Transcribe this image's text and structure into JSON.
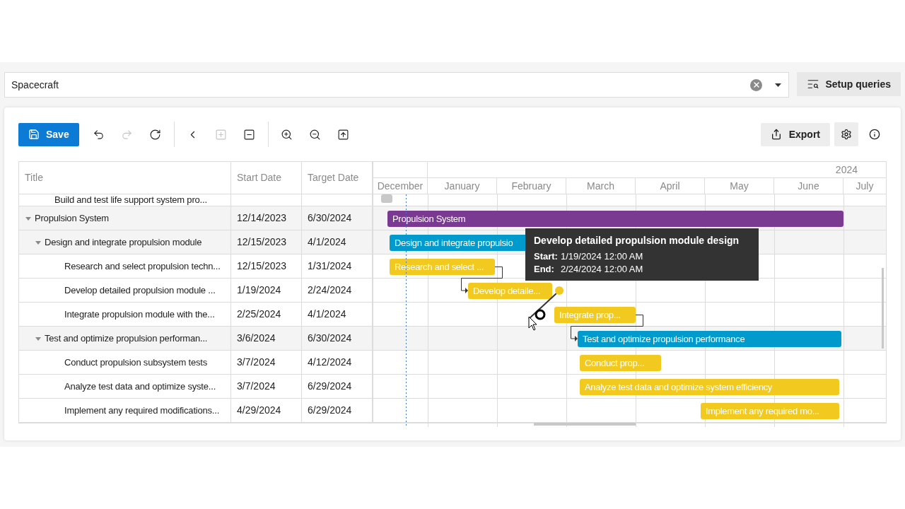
{
  "search": {
    "value": "Spacecraft"
  },
  "setup_button": "Setup queries",
  "toolbar": {
    "save": "Save",
    "tools": [
      {
        "kind": "undo",
        "disabled": false
      },
      {
        "kind": "redo",
        "disabled": true
      },
      {
        "kind": "refresh",
        "disabled": false
      },
      {
        "kind": "separator"
      },
      {
        "kind": "back",
        "disabled": false
      },
      {
        "kind": "expand",
        "disabled": true
      },
      {
        "kind": "collapse",
        "disabled": false
      },
      {
        "kind": "separator"
      },
      {
        "kind": "zoom-in",
        "disabled": false
      },
      {
        "kind": "zoom-out",
        "disabled": false
      },
      {
        "kind": "fit",
        "disabled": false
      }
    ],
    "export": "Export"
  },
  "grid": {
    "columns": [
      "Title",
      "Start Date",
      "Target Date"
    ],
    "year": "2024",
    "months": [
      "December",
      "January",
      "February",
      "March",
      "April",
      "May",
      "June",
      "July"
    ],
    "tasks": [
      {
        "title": "Build and test life support system pro..."
      },
      {
        "title": "Propulsion System",
        "start": "12/14/2023",
        "target": "6/30/2024",
        "expanded": true,
        "bar": {
          "label": "Propulsion System",
          "color": "#7a3a91"
        },
        "children": [
          {
            "title": "Design and integrate propulsion module",
            "start": "12/15/2023",
            "target": "4/1/2024",
            "expanded": true,
            "bar": {
              "label": "Design and integrate propulsio",
              "color": "#009bcc"
            },
            "children": [
              {
                "title": "Research and select propulsion techn...",
                "start": "12/15/2023",
                "target": "1/31/2024",
                "bar": {
                  "label": "Research and select ...",
                  "color": "#f2c91f"
                }
              },
              {
                "title": "Develop detailed propulsion module ...",
                "start": "1/19/2024",
                "target": "2/24/2024",
                "bar": {
                  "label": "Develop detaile...",
                  "color": "#f2c91f"
                }
              },
              {
                "title": "Integrate propulsion module with the...",
                "start": "2/25/2024",
                "target": "4/1/2024",
                "bar": {
                  "label": "Integrate prop...",
                  "color": "#f2c91f"
                }
              }
            ]
          },
          {
            "title": "Test and optimize propulsion performan...",
            "start": "3/6/2024",
            "target": "6/30/2024",
            "expanded": true,
            "bar": {
              "label": "Test and optimize propulsion performance",
              "color": "#009bcc"
            },
            "children": [
              {
                "title": "Conduct propulsion subsystem tests",
                "start": "3/7/2024",
                "target": "4/12/2024",
                "bar": {
                  "label": "Conduct prop...",
                  "color": "#f2c91f"
                }
              },
              {
                "title": "Analyze test data and optimize syste...",
                "start": "3/7/2024",
                "target": "6/29/2024",
                "bar": {
                  "label": "Analyze test data and optimize system efficiency",
                  "color": "#f2c91f"
                }
              },
              {
                "title": "Implement any required modifications...",
                "start": "4/29/2024",
                "target": "6/29/2024",
                "bar": {
                  "label": "Implement any required mo...",
                  "color": "#f2c91f"
                }
              }
            ]
          }
        ]
      }
    ]
  },
  "tooltip": {
    "title": "Develop detailed propulsion module design",
    "lines": [
      {
        "label": "Start:",
        "value": "1/19/2024 12:00 AM"
      },
      {
        "label": "End:",
        "value": "2/24/2024 12:00 AM"
      }
    ]
  }
}
